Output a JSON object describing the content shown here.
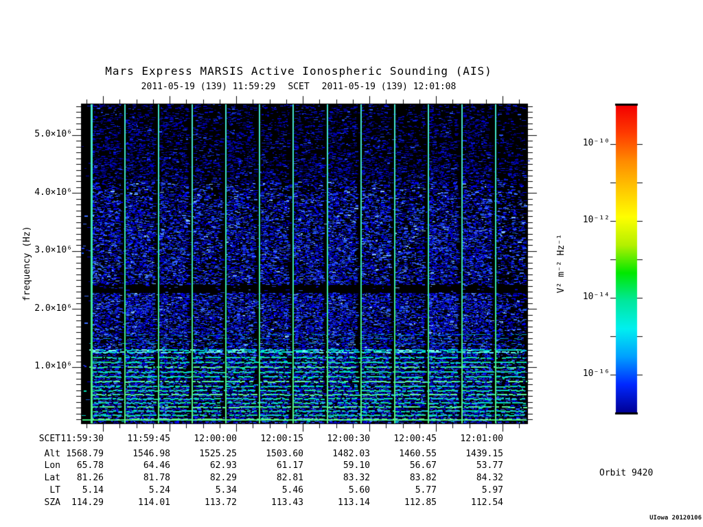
{
  "header": {
    "title": "Mars Express MARSIS Active Ionospheric Sounding (AIS)",
    "subtitle": {
      "start_time": "2011-05-19 (139) 11:59:29",
      "scet_label": "SCET",
      "end_time": "2011-05-19 (139) 12:01:08"
    }
  },
  "y_axis": {
    "label": "frequency (Hz)",
    "ticks": [
      "5.0×10⁶",
      "4.0×10⁶",
      "3.0×10⁶",
      "2.0×10⁶",
      "1.0×10⁶"
    ]
  },
  "colorbar": {
    "unit_label": "V² m⁻² Hz⁻¹",
    "ticks": [
      "10⁻¹⁰",
      "10⁻¹²",
      "10⁻¹⁴",
      "10⁻¹⁶"
    ]
  },
  "ephemeris": {
    "rows": [
      {
        "label": "SCET",
        "values": [
          "11:59:30",
          "11:59:45",
          "12:00:00",
          "12:00:15",
          "12:00:30",
          "12:00:45",
          "12:01:00"
        ]
      },
      {
        "label": "Alt",
        "values": [
          "1568.79",
          "1546.98",
          "1525.25",
          "1503.60",
          "1482.03",
          "1460.55",
          "1439.15"
        ]
      },
      {
        "label": "Lon",
        "values": [
          "65.78",
          "64.46",
          "62.93",
          "61.17",
          "59.10",
          "56.67",
          "53.77"
        ]
      },
      {
        "label": "Lat",
        "values": [
          "81.26",
          "81.78",
          "82.29",
          "82.81",
          "83.32",
          "83.82",
          "84.32"
        ]
      },
      {
        "label": "LT",
        "values": [
          "5.14",
          "5.24",
          "5.34",
          "5.46",
          "5.60",
          "5.77",
          "5.97"
        ]
      },
      {
        "label": "SZA",
        "values": [
          "114.29",
          "114.01",
          "113.72",
          "113.43",
          "113.14",
          "112.85",
          "112.54"
        ]
      }
    ]
  },
  "footer": {
    "orbit_label": "Orbit 9420",
    "credit": "UIowa 20120106"
  },
  "chart_data": {
    "type": "heatmap",
    "subtype": "radar sounder spectrogram",
    "title": "Mars Express MARSIS Active Ionospheric Sounding (AIS)",
    "x_axis": {
      "label": "SCET",
      "start": "2011-05-19 (139) 11:59:29",
      "end": "2011-05-19 (139) 12:01:08",
      "ticks": [
        "11:59:30",
        "11:59:45",
        "12:00:00",
        "12:00:15",
        "12:00:30",
        "12:00:45",
        "12:01:00"
      ],
      "tick_interval_s": 15
    },
    "y_axis": {
      "label": "frequency (Hz)",
      "range_hz": [
        30000,
        5530000
      ],
      "major_ticks_hz": [
        1000000,
        2000000,
        3000000,
        4000000,
        5000000
      ],
      "minor_tick_step_hz": 100000
    },
    "intensity": {
      "unit": "V² m⁻² Hz⁻¹",
      "scale": "log",
      "labeled_tick_exponents": [
        -10,
        -12,
        -14,
        -16
      ],
      "colormap_bottom_to_top": [
        "#000096",
        "#0028ff",
        "#00a0ff",
        "#00f0f0",
        "#00e89c",
        "#00e800",
        "#b4f000",
        "#ffff00",
        "#ffc800",
        "#ff8c00",
        "#ff3c00",
        "#f40000"
      ]
    },
    "features": {
      "background": "blue receiver noise speckle over black",
      "sounder_pulses": {
        "count": 13,
        "interval_s": 7.5,
        "appearance": "vertical cyan-green lines spanning all frequencies"
      },
      "quiet_band_hz": [
        2280000,
        2430000
      ],
      "harmonic_emission_boundary_hz": 1350000,
      "harmonic_stripes": "closely spaced horizontal cyan/green lines below boundary, brightest near 100-600 kHz",
      "bright_baseline_hz": 80000
    },
    "orbit": 9420
  }
}
